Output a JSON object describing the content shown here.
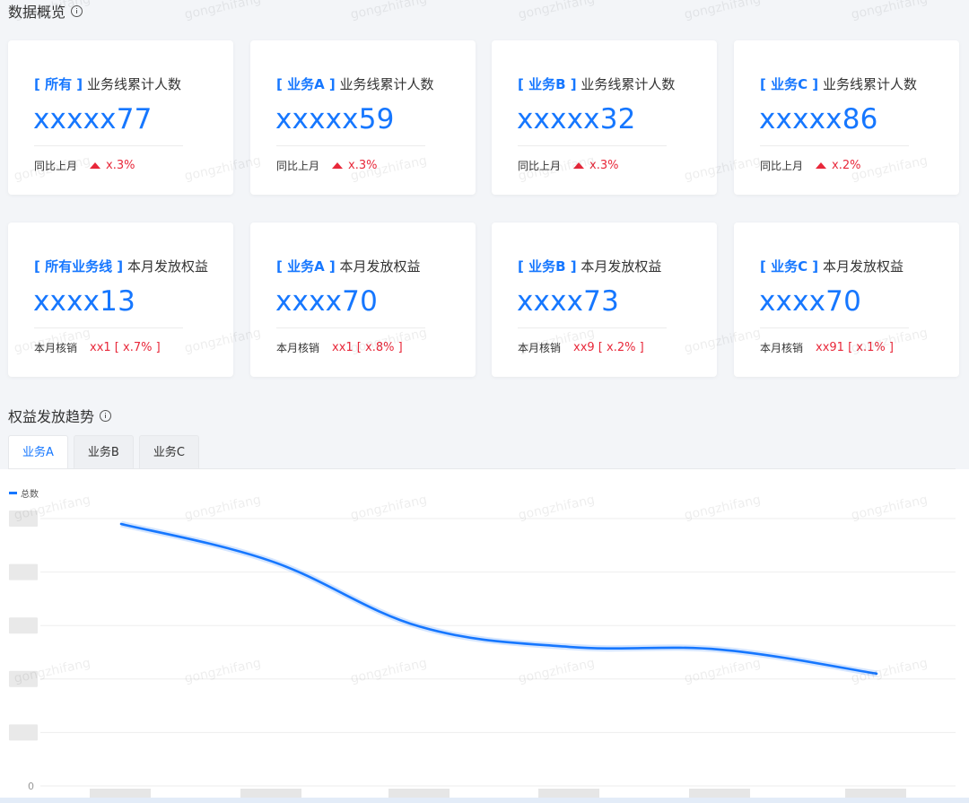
{
  "overview": {
    "title": "数据概览"
  },
  "cards_row1": [
    {
      "tag": "[ 所有 ]",
      "label": "业务线累计人数",
      "value": "xxxxx77",
      "foot_label": "同比上月",
      "foot_value": "x.3%"
    },
    {
      "tag": "[ 业务A ]",
      "label": "业务线累计人数",
      "value": "xxxxx59",
      "foot_label": "同比上月",
      "foot_value": "x.3%"
    },
    {
      "tag": "[ 业务B ]",
      "label": "业务线累计人数",
      "value": "xxxxx32",
      "foot_label": "同比上月",
      "foot_value": "x.3%"
    },
    {
      "tag": "[ 业务C ]",
      "label": "业务线累计人数",
      "value": "xxxxx86",
      "foot_label": "同比上月",
      "foot_value": "x.2%"
    }
  ],
  "cards_row2": [
    {
      "tag": "[ 所有业务线 ]",
      "label": "本月发放权益",
      "value": "xxxx13",
      "foot_label": "本月核销",
      "foot_value": "xx1 [ x.7% ]"
    },
    {
      "tag": "[ 业务A ]",
      "label": "本月发放权益",
      "value": "xxxx70",
      "foot_label": "本月核销",
      "foot_value": "xx1 [ x.8% ]"
    },
    {
      "tag": "[ 业务B ]",
      "label": "本月发放权益",
      "value": "xxxx73",
      "foot_label": "本月核销",
      "foot_value": "xx9 [ x.2% ]"
    },
    {
      "tag": "[ 业务C ]",
      "label": "本月发放权益",
      "value": "xxxx70",
      "foot_label": "本月核销",
      "foot_value": "xx91 [ x.1% ]"
    }
  ],
  "trend": {
    "title": "权益发放趋势",
    "tabs": [
      "业务A",
      "业务B",
      "业务C"
    ],
    "active_tab": 0
  },
  "watermark_text": "gongzhifang",
  "colors": {
    "accent": "#1677ff",
    "up": "#e8283a"
  },
  "chart_data": {
    "type": "line",
    "legend_position": "top-left",
    "grid": true,
    "y_tick_labels": [
      "",
      "",
      "",
      "",
      "",
      "0"
    ],
    "x_tick_labels": [
      "",
      "",
      "",
      "",
      "",
      ""
    ],
    "ylim": [
      0,
      5
    ],
    "series": [
      {
        "name": "总数",
        "values": [
          4.9,
          4.2,
          2.98,
          2.6,
          2.55,
          2.1
        ]
      }
    ]
  }
}
